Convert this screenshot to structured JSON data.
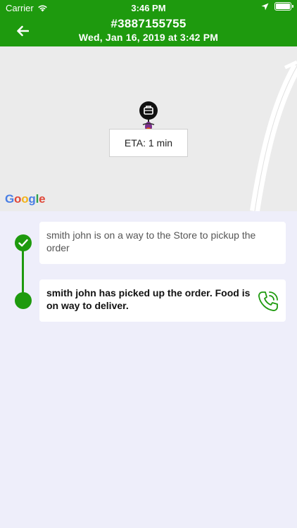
{
  "status_bar": {
    "carrier": "Carrier",
    "time": "3:46 PM",
    "icons": [
      "wifi-icon",
      "location-arrow-icon",
      "battery-icon"
    ]
  },
  "nav": {
    "back_icon": "back-arrow-icon",
    "title": "#3887155755",
    "subtitle": "Wed, Jan 16, 2019 at 3:42 PM"
  },
  "map": {
    "eta": "ETA: 1 min",
    "logo": "Google",
    "marker_icon": "courier-marker-icon"
  },
  "timeline": [
    {
      "text": "smith john is on a way to the Store to pickup the order",
      "status": "completed"
    },
    {
      "text": "smith john has picked up the order. Food is on way to deliver.",
      "status": "current",
      "action_icon": "phone-icon"
    }
  ],
  "colors": {
    "accent": "#1e9a0e",
    "background": "#eeeefa",
    "map": "#ebebeb"
  }
}
